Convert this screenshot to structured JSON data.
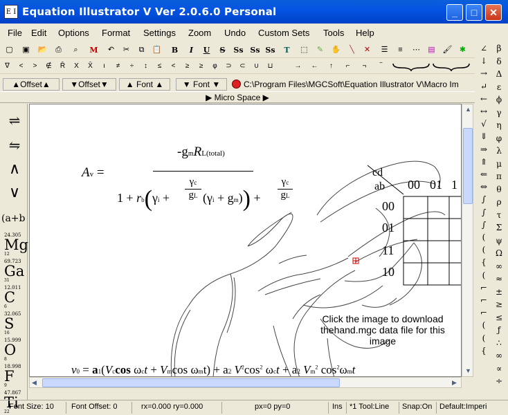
{
  "window": {
    "title": "Equation Illustrator V  Ver 2.0.6.0 Personal",
    "icon_text": "E I"
  },
  "menu": [
    "File",
    "Edit",
    "Options",
    "Format",
    "Settings",
    "Zoom",
    "Undo",
    "Custom Sets",
    "Tools",
    "Help"
  ],
  "toolbar1": [
    "new-icon",
    "open-icon",
    "open-folder-icon",
    "print-icon",
    "save-icon",
    "M",
    "undo-icon",
    "cut-icon",
    "copy-icon",
    "paste-icon",
    "B",
    "I",
    "U",
    "S",
    "Ss",
    "Ss",
    "Ss",
    "T",
    "select-icon",
    "pencil-icon",
    "hand-icon",
    "line-icon",
    "delete-icon",
    "lines-icon",
    "thick-lines-icon",
    "dots-icon",
    "colors-icon",
    "brush-icon",
    "star-icon"
  ],
  "toolbar3": [
    "∇",
    "<",
    ">",
    "∉",
    "R̄",
    "X",
    "X̄",
    "ι",
    "≠",
    "÷",
    "↕",
    "≤",
    "<",
    "≥",
    "≥",
    "φ",
    "⊃",
    "⊂",
    "∪",
    "⊔",
    "→",
    "←",
    "↑",
    "⌐",
    "¬",
    "‾"
  ],
  "offset": {
    "up1": "▲Offset▲",
    "down1": "▼Offset▼",
    "up2": "▲ Font ▲",
    "down2": "▼ Font ▼",
    "path": "C:\\Program Files\\MGCSoft\\Equation Illustrator V\\Macro Im"
  },
  "micro_space": "▶ Micro Space ▶",
  "left_symbols": [
    "⇌",
    "⇋",
    "∧",
    "∨",
    "(a+b"
  ],
  "elements": [
    {
      "num": "24.305",
      "sym": "Mg",
      "mass": "12"
    },
    {
      "num": "69.723",
      "sym": "Ga",
      "mass": "31"
    },
    {
      "num": "12.011",
      "sym": "C",
      "mass": "6"
    },
    {
      "num": "32.065",
      "sym": "S",
      "mass": "16"
    },
    {
      "num": "15.999",
      "sym": "O",
      "mass": "8"
    },
    {
      "num": "18.998",
      "sym": "F",
      "mass": "9"
    },
    {
      "num": "47.867",
      "sym": "Ti",
      "mass": "22"
    }
  ],
  "right_col1": [
    "∠",
    "↓",
    "→",
    "↵",
    "←",
    "↔",
    "√",
    "⇓",
    "⇒",
    "⇑",
    "⇐",
    "⇔",
    "∫",
    "∫",
    "∫",
    "(",
    "(",
    "{",
    "(",
    "⌐",
    "⌐",
    "⌐",
    "(",
    "(",
    "{"
  ],
  "right_col2": [
    "β",
    "δ",
    "Δ",
    "ε",
    "ϕ",
    "γ",
    "η",
    "φ",
    "λ",
    "μ",
    "π",
    "θ",
    "ρ",
    "τ",
    "Σ",
    "ψ",
    "Ω",
    "∞",
    "≈",
    "±",
    "≥",
    "≤",
    "ƒ",
    "∴",
    "∞",
    "∝",
    "÷"
  ],
  "canvas": {
    "click_text": "Click the image to download thehand.mgc data file for this image",
    "kmap": {
      "row_label": "ab",
      "col_label": "cd",
      "cols": [
        "00",
        "01",
        "1"
      ],
      "rows": [
        "00",
        "01",
        "11",
        "10"
      ]
    }
  },
  "status": {
    "font_size": "Font Size: 10",
    "font_offset": "Font Offset: 0",
    "rx": "rx=0.000 ry=0.000",
    "px": "px=0 py=0",
    "ins": "Ins",
    "tool": "*1 Tool:Line",
    "snap": "Snap:On",
    "default": "Default:Imperi"
  }
}
